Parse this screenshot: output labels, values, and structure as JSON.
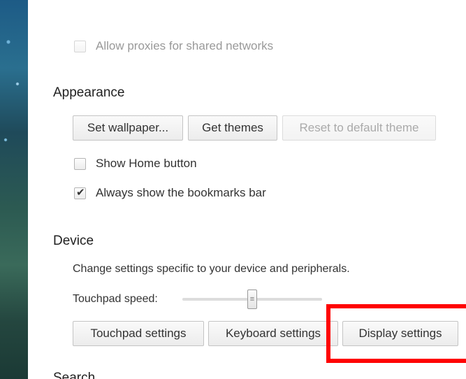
{
  "network": {
    "allow_proxies_label": "Allow proxies for shared networks"
  },
  "appearance": {
    "title": "Appearance",
    "set_wallpaper_label": "Set wallpaper...",
    "get_themes_label": "Get themes",
    "reset_theme_label": "Reset to default theme",
    "show_home_label": "Show Home button",
    "show_home_checked": false,
    "bookmarks_bar_label": "Always show the bookmarks bar",
    "bookmarks_bar_checked": true
  },
  "device": {
    "title": "Device",
    "description": "Change settings specific to your device and peripherals.",
    "touchpad_speed_label": "Touchpad speed:",
    "touchpad_speed_level": 0.5,
    "touchpad_settings_label": "Touchpad settings",
    "keyboard_settings_label": "Keyboard settings",
    "display_settings_label": "Display settings"
  },
  "search": {
    "title": "Search"
  },
  "icons": {
    "check": "checkmark-icon",
    "slider_grip": "grip-icon"
  },
  "colors": {
    "highlight": "#ff0000"
  }
}
